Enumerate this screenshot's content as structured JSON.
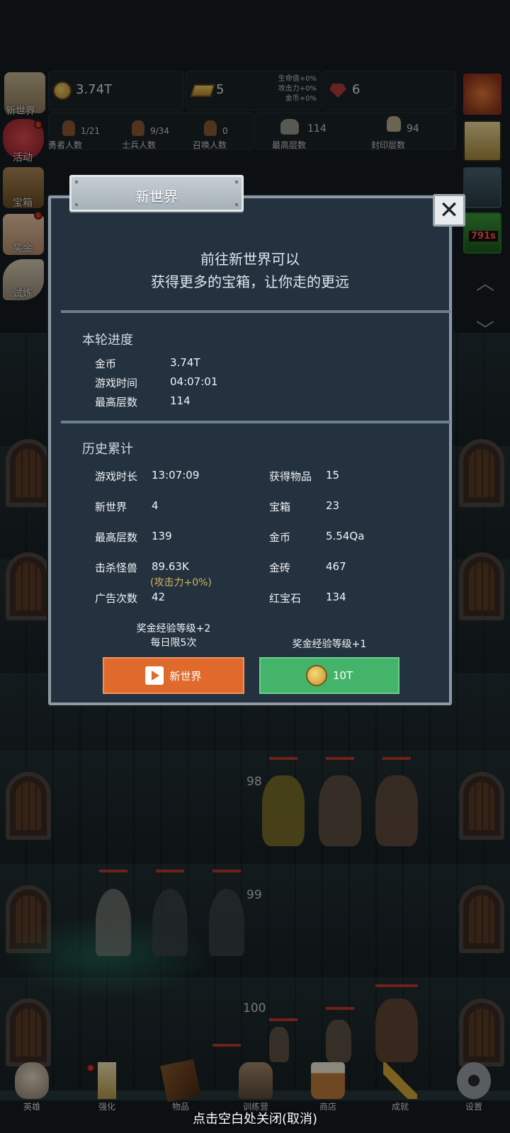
{
  "hud": {
    "gold": "3.74T",
    "gold_bars": "5",
    "rubies": "6",
    "bonuses": [
      "生命值+0%",
      "攻击力+0%",
      "金币+0%"
    ],
    "counts": [
      {
        "value": "1/21",
        "label": "勇者人数"
      },
      {
        "value": "9/34",
        "label": "士兵人数"
      },
      {
        "value": "0",
        "label": "召唤人数"
      },
      {
        "value": "114",
        "label": "最高层数"
      },
      {
        "value": "94",
        "label": "封印层数"
      }
    ]
  },
  "side_menu": [
    "新世界",
    "活动",
    "宝箱",
    "奖金",
    "试炼"
  ],
  "right_panel": {
    "timer": "791s"
  },
  "floors": [
    "98",
    "99",
    "100"
  ],
  "dialog": {
    "title": "新世界",
    "desc_line1": "前往新世界可以",
    "desc_line2": "获得更多的宝箱，让你走的更远",
    "progress_title": "本轮进度",
    "progress": [
      {
        "key": "金币",
        "value": "3.74T"
      },
      {
        "key": "游戏时间",
        "value": "04:07:01"
      },
      {
        "key": "最高层数",
        "value": "114"
      }
    ],
    "history_title": "历史累计",
    "history_left": [
      {
        "key": "游戏时长",
        "value": "13:07:09"
      },
      {
        "key": "新世界",
        "value": "4"
      },
      {
        "key": "最高层数",
        "value": "139"
      },
      {
        "key": "击杀怪兽",
        "value": "89.63K"
      },
      {
        "key": "广告次数",
        "value": "42"
      }
    ],
    "attack_note": "(攻击力+0%)",
    "history_right": [
      {
        "key": "获得物品",
        "value": "15"
      },
      {
        "key": "宝箱",
        "value": "23"
      },
      {
        "key": "金币",
        "value": "5.54Qa"
      },
      {
        "key": "金砖",
        "value": "467"
      },
      {
        "key": "红宝石",
        "value": "134"
      }
    ],
    "left_note_1": "奖金经验等级+2",
    "left_note_2": "每日限5次",
    "right_note": "奖金经验等级+1",
    "ad_button": "新世界",
    "coin_button": "10T"
  },
  "nav": [
    "英雄",
    "强化",
    "物品",
    "训练营",
    "商店",
    "成就",
    "设置"
  ],
  "close_hint": "点击空白处关闭(取消)",
  "colors": {
    "orange_button": "#e06a2c",
    "green_button": "#43b469",
    "dialog_bg": "#243240"
  }
}
